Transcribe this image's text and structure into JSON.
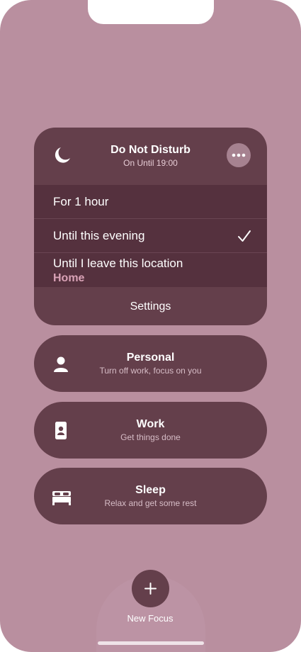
{
  "dnd": {
    "title": "Do Not Disturb",
    "subtitle": "On Until 19:00",
    "options": [
      {
        "label": "For 1 hour"
      },
      {
        "label": "Until this evening",
        "selected": true
      },
      {
        "label": "Until I leave this location",
        "location": "Home"
      }
    ],
    "settings_label": "Settings"
  },
  "focus_modes": [
    {
      "title": "Personal",
      "subtitle": "Turn off work, focus on you",
      "icon": "person-icon"
    },
    {
      "title": "Work",
      "subtitle": "Get things done",
      "icon": "badge-icon"
    },
    {
      "title": "Sleep",
      "subtitle": "Relax and get some rest",
      "icon": "bed-icon"
    }
  ],
  "new_focus_label": "New Focus",
  "colors": {
    "background": "#b98f9f",
    "card": "#643f4b",
    "option_list": "#55313e",
    "location_accent": "#d9a2b6"
  }
}
